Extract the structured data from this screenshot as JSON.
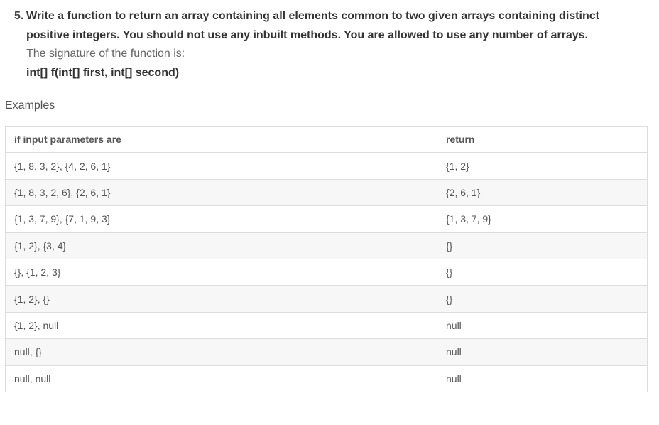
{
  "question": {
    "number": "5.",
    "line1": "Write a function to return an array containing all elements common to two given arrays containing distinct",
    "line2": "positive integers. You should not use any inbuilt methods. You are allowed to use any number of arrays.",
    "signature_label": "The signature of the function is:",
    "signature": "int[] f(int[] first, int[] second)"
  },
  "examples": {
    "heading": "Examples",
    "columns": [
      "if input parameters are",
      "return"
    ],
    "rows": [
      [
        "{1, 8, 3, 2}, {4, 2, 6, 1}",
        "{1, 2}"
      ],
      [
        "{1, 8, 3, 2, 6}, {2, 6, 1}",
        "{2, 6, 1}"
      ],
      [
        "{1, 3, 7, 9}, {7, 1, 9, 3}",
        "{1, 3, 7, 9}"
      ],
      [
        "{1, 2}, {3, 4}",
        "{}"
      ],
      [
        "{}, {1, 2, 3}",
        "{}"
      ],
      [
        "{1, 2}, {}",
        "{}"
      ],
      [
        "{1, 2}, null",
        "null"
      ],
      [
        "null, {}",
        "null"
      ],
      [
        "null, null",
        "null"
      ]
    ]
  }
}
